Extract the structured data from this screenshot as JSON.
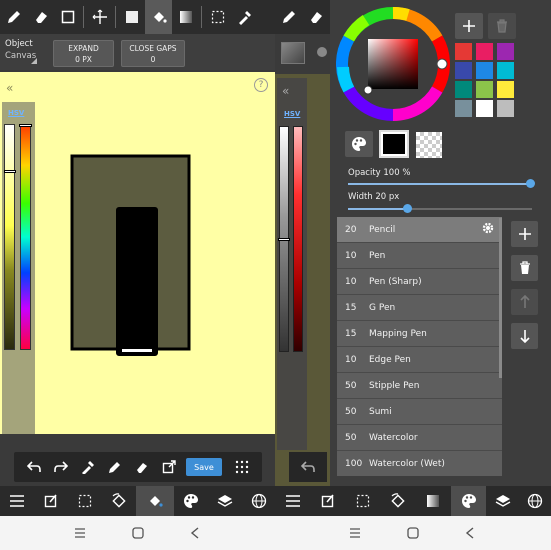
{
  "left_pane": {
    "object_label": "Object",
    "canvas_label": "Canvas",
    "expand_label": "EXPAND",
    "expand_value": "0 PX",
    "close_gaps_label": "CLOSE GAPS",
    "close_gaps_value": "0",
    "help_glyph": "?",
    "hsv_label": "HSV",
    "save_label": "Save",
    "canvas_color": "#ffffa5"
  },
  "mid_strip": {
    "hsv_label": "HSV"
  },
  "right_pane": {
    "opacity_label": "Opacity 100 %",
    "opacity_value": 100,
    "width_label": "Width 20 px",
    "width_value": 20,
    "swatches": [
      "#e53935",
      "#e91e63",
      "#9c27b0",
      "#3949ab",
      "#1e88e5",
      "#00bcd4",
      "#00897b",
      "#8bc34a",
      "#ffeb3b",
      "#78909c",
      "#ffffff",
      "#bdbdbd"
    ],
    "brushes": [
      {
        "size": "20",
        "name": "Pencil"
      },
      {
        "size": "10",
        "name": "Pen"
      },
      {
        "size": "10",
        "name": "Pen (Sharp)"
      },
      {
        "size": "15",
        "name": "G Pen"
      },
      {
        "size": "15",
        "name": "Mapping Pen"
      },
      {
        "size": "10",
        "name": "Edge Pen"
      },
      {
        "size": "50",
        "name": "Stipple Pen"
      },
      {
        "size": "50",
        "name": "Sumi"
      },
      {
        "size": "50",
        "name": "Watercolor"
      },
      {
        "size": "100",
        "name": "Watercolor (Wet)"
      }
    ],
    "selected_brush": "Pencil",
    "current_color": "#000000"
  },
  "icons": {
    "top_left": [
      "pencil-icon",
      "eraser-icon",
      "select-rect-icon",
      "move-icon",
      "fill-rect-icon",
      "bucket-icon",
      "gradient-icon",
      "lasso-icon",
      "eyedropper-icon"
    ],
    "bottom": [
      "menu-icon",
      "edit-icon",
      "selection-icon",
      "rotate-icon",
      "bucket-icon",
      "palette-icon",
      "layers-icon",
      "globe-icon"
    ]
  }
}
